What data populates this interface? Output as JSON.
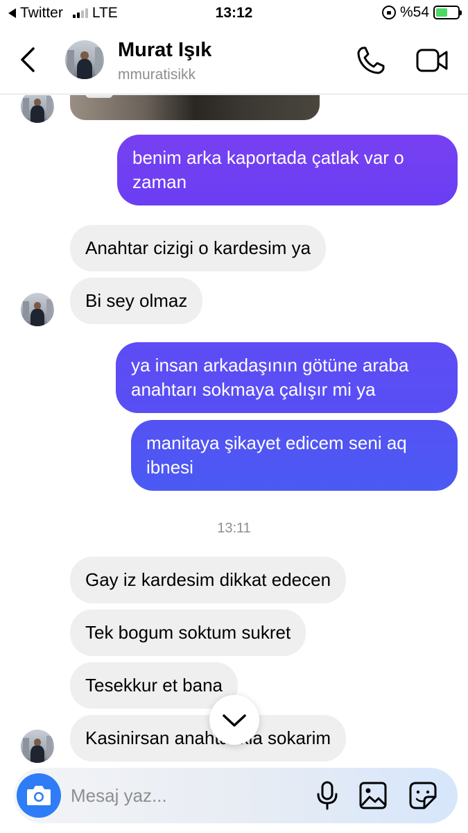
{
  "status_bar": {
    "carrier_back": "Twitter",
    "network": "LTE",
    "time": "13:12",
    "battery": "%54",
    "battery_level": 0.54,
    "signal_bars": 2
  },
  "header": {
    "name": "Murat Işık",
    "username": "mmuratisikk",
    "icons": [
      "back-chevron-icon",
      "phone-icon",
      "video-camera-icon"
    ]
  },
  "messages": [
    {
      "dir": "out",
      "text": "benim arka kaportada çatlak var o zaman"
    },
    {
      "dir": "in",
      "text": "Anahtar cizigi o kardesim ya"
    },
    {
      "dir": "in",
      "text": "Bi sey olmaz"
    },
    {
      "dir": "out",
      "text": "ya insan arkadaşının götüne araba anahtarı sokmaya çalışır mi ya"
    },
    {
      "dir": "out",
      "text": "manitaya şikayet edicem seni aq ibnesi"
    },
    {
      "dir": "in",
      "text": "Gay iz kardesim dikkat edecen"
    },
    {
      "dir": "in",
      "text": "Tek bogum soktum sukret"
    },
    {
      "dir": "in",
      "text": "Tesekkur et bana"
    },
    {
      "dir": "in",
      "text": "Kasinirsan anahtarikla sokarim"
    }
  ],
  "timestamp": "13:11",
  "composer": {
    "placeholder": "Mesaj yaz...",
    "icons": [
      "camera-icon",
      "microphone-icon",
      "gallery-icon",
      "sticker-icon"
    ]
  },
  "colors": {
    "outgoing_top": "#7740f2",
    "outgoing_bottom": "#4a5af3",
    "incoming": "#efefef",
    "camera_button": "#2e7cf6"
  }
}
